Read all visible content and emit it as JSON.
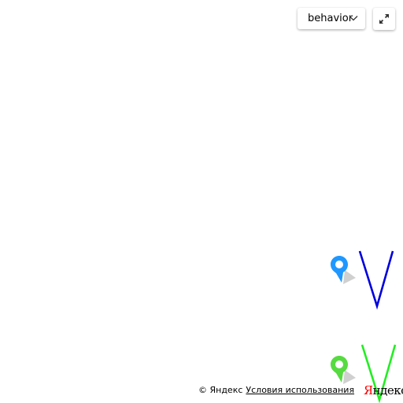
{
  "controls": {
    "dropdown": {
      "label": "behavior",
      "icon": "chevron-down-icon"
    },
    "fullscreen": {
      "icon": "expand-icon"
    }
  },
  "markers": [
    {
      "type": "placemark",
      "color": "#1e98ff"
    },
    {
      "type": "v-mark",
      "color": "#0000dd"
    },
    {
      "type": "placemark",
      "color": "#56db40"
    },
    {
      "type": "v-mark",
      "color": "#22ee22"
    }
  ],
  "footer": {
    "copyright": "© Яндекс",
    "terms_link": "Условия использования",
    "logo_first": "Я",
    "logo_rest": "ндекс",
    "logo_accent": "#ff0000"
  }
}
